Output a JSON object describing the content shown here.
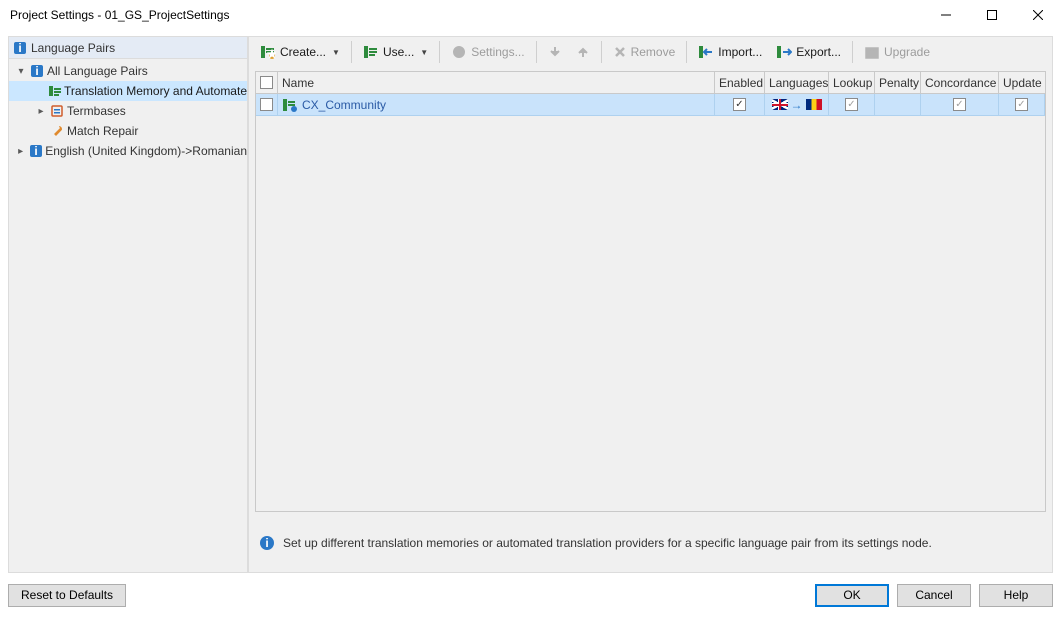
{
  "window": {
    "title": "Project Settings - 01_GS_ProjectSettings"
  },
  "sidebar": {
    "header": "Language Pairs",
    "items": [
      {
        "label": "All Language Pairs",
        "indent": 1,
        "twisty": "▾",
        "icon": "lang-icon",
        "selected": false
      },
      {
        "label": "Translation Memory and Automate",
        "indent": 2,
        "twisty": "",
        "icon": "tm-icon",
        "selected": true
      },
      {
        "label": "Termbases",
        "indent": 2,
        "twisty": "▸",
        "icon": "termbase-icon",
        "selected": false
      },
      {
        "label": "Match Repair",
        "indent": 2,
        "twisty": "",
        "icon": "wrench-icon",
        "selected": false
      },
      {
        "label": "English (United Kingdom)->Romanian",
        "indent": 1,
        "twisty": "▸",
        "icon": "lang-icon",
        "selected": false
      }
    ]
  },
  "toolbar": {
    "create": "Create...",
    "use": "Use...",
    "settings": "Settings...",
    "remove": "Remove",
    "import": "Import...",
    "export": "Export...",
    "upgrade": "Upgrade"
  },
  "grid": {
    "headers": {
      "name": "Name",
      "enabled": "Enabled",
      "languages": "Languages",
      "lookup": "Lookup",
      "penalty": "Penalty",
      "concordance": "Concordance",
      "update": "Update"
    },
    "rows": [
      {
        "name": "CX_Community",
        "enabled": true,
        "lookup": true,
        "penalty": "",
        "concordance": true,
        "update": true,
        "selected": true
      }
    ]
  },
  "info": "Set up different translation memories or automated translation providers for a specific language pair from its settings node.",
  "footer": {
    "reset": "Reset to Defaults",
    "ok": "OK",
    "cancel": "Cancel",
    "help": "Help"
  }
}
